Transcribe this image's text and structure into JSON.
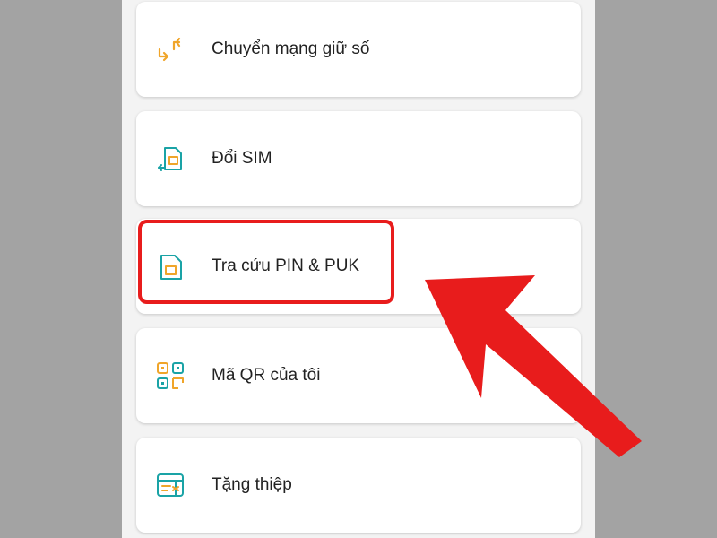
{
  "menu": {
    "items": [
      {
        "label": "Chuyển mạng giữ số",
        "icon": "swap-arrows-icon"
      },
      {
        "label": "Đổi SIM",
        "icon": "sim-swap-icon"
      },
      {
        "label": "Tra cứu PIN & PUK",
        "icon": "sim-card-icon"
      },
      {
        "label": "Mã QR của tôi",
        "icon": "qr-code-icon"
      },
      {
        "label": "Tặng thiệp",
        "icon": "gift-card-icon"
      }
    ]
  },
  "annotation": {
    "highlighted_item": "Tra cứu PIN & PUK",
    "color": "#e81c1c"
  },
  "colors": {
    "icon_orange": "#f0a52a",
    "icon_teal": "#1aa3a6",
    "background": "#a3a3a3",
    "card": "#ffffff"
  }
}
